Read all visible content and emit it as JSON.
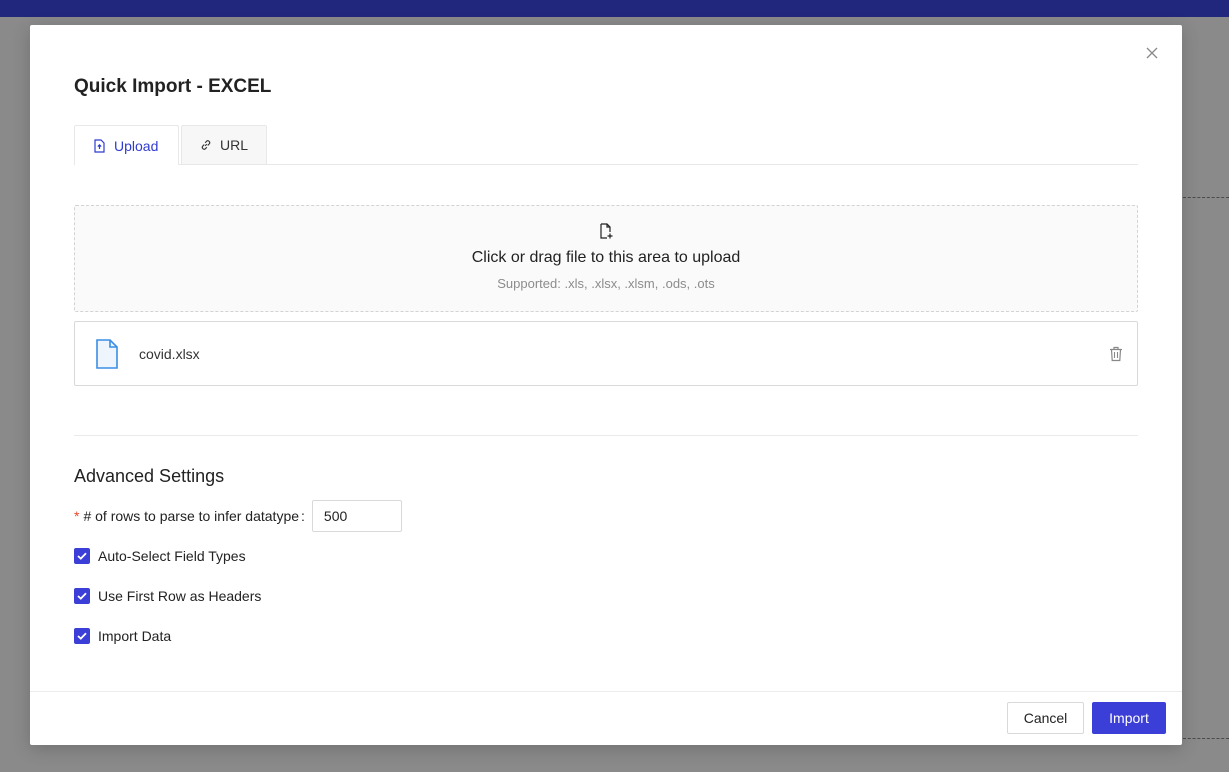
{
  "modal": {
    "title": "Quick Import - EXCEL",
    "tabs": [
      {
        "label": "Upload",
        "icon": "upload-file-icon",
        "active": true
      },
      {
        "label": "URL",
        "icon": "link-icon",
        "active": false
      }
    ],
    "dropzone": {
      "text": "Click or drag file to this area to upload",
      "hint": "Supported: .xls, .xlsx, .xlsm, .ods, .ots",
      "icon": "file-add-icon"
    },
    "file": {
      "name": "covid.xlsx",
      "icon": "file-icon",
      "delete_icon": "trash-icon"
    },
    "advanced": {
      "title": "Advanced Settings",
      "rows_label": "# of rows to parse to infer datatype",
      "rows_required_mark": "*",
      "rows_value": "500",
      "checkboxes": [
        {
          "label": "Auto-Select Field Types",
          "checked": true
        },
        {
          "label": "Use First Row as Headers",
          "checked": true
        },
        {
          "label": "Import Data",
          "checked": true
        }
      ]
    },
    "footer": {
      "cancel_label": "Cancel",
      "import_label": "Import"
    }
  },
  "colors": {
    "accent": "#3b3fd8",
    "topbar": "#22277e",
    "required": "#e8482c"
  }
}
